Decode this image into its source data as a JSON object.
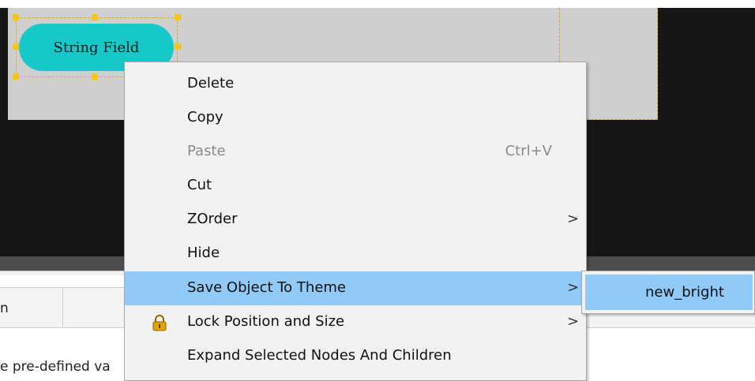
{
  "canvas": {
    "node_label": "String Field"
  },
  "panel": {
    "column_text": "n",
    "description_text": "e pre-defined va"
  },
  "context_menu": {
    "items": [
      {
        "label": "Delete",
        "shortcut": "",
        "submenu": false,
        "enabled": true,
        "icon": ""
      },
      {
        "label": "Copy",
        "shortcut": "",
        "submenu": false,
        "enabled": true,
        "icon": ""
      },
      {
        "label": "Paste",
        "shortcut": "Ctrl+V",
        "submenu": false,
        "enabled": false,
        "icon": ""
      },
      {
        "label": "Cut",
        "shortcut": "",
        "submenu": false,
        "enabled": true,
        "icon": ""
      },
      {
        "label": "ZOrder",
        "shortcut": "",
        "submenu": true,
        "enabled": true,
        "icon": ""
      },
      {
        "label": "Hide",
        "shortcut": "",
        "submenu": false,
        "enabled": true,
        "icon": ""
      },
      {
        "label": "Save Object To Theme",
        "shortcut": "",
        "submenu": true,
        "enabled": true,
        "icon": "",
        "highlighted": true
      },
      {
        "label": "Lock Position and Size",
        "shortcut": "",
        "submenu": true,
        "enabled": true,
        "icon": "lock-icon"
      },
      {
        "label": "Expand Selected Nodes And Children",
        "shortcut": "",
        "submenu": false,
        "enabled": true,
        "icon": ""
      }
    ],
    "submenu_arrow": ">"
  },
  "theme_submenu": {
    "items": [
      {
        "label": "new_bright",
        "highlighted": true
      }
    ]
  },
  "colors": {
    "node_fill": "#16c8c8",
    "selection_handles": "#f6c51a",
    "menu_highlight": "#91c9f7",
    "lock_icon": "#e5a20a"
  }
}
